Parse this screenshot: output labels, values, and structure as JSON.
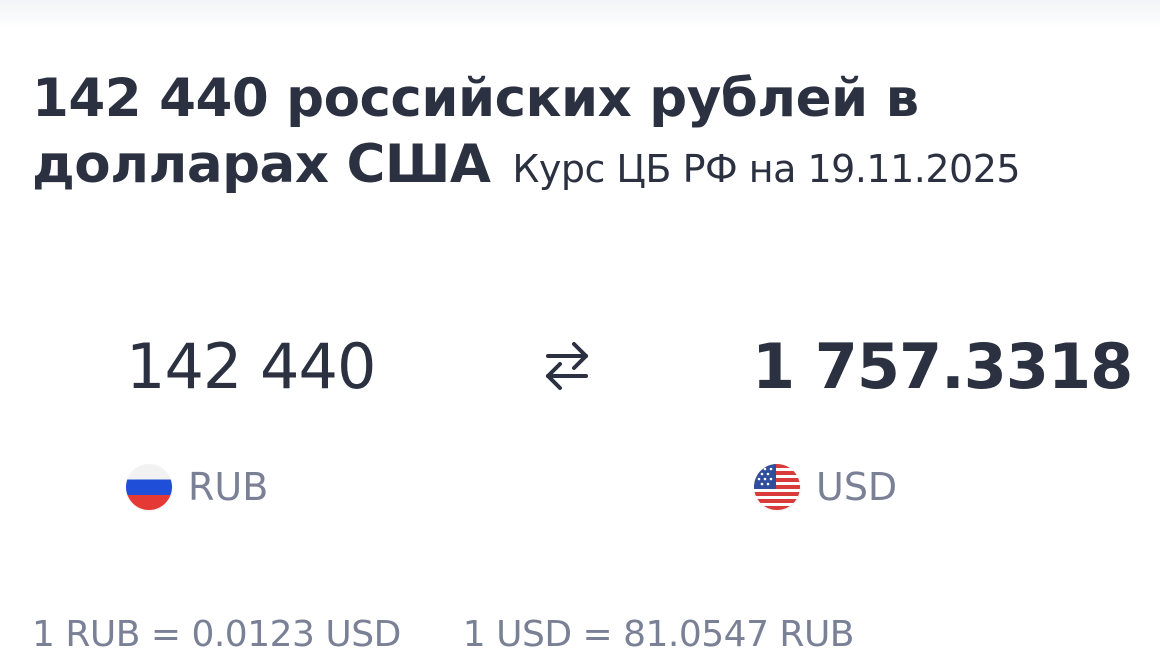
{
  "header": {
    "title": "142 440 российских рублей в долларах США",
    "subtitle": "Курс ЦБ РФ на 19.11.2025"
  },
  "converter": {
    "from": {
      "amount": "142 440",
      "code": "RUB",
      "flag_icon": "russia-flag-icon"
    },
    "to": {
      "amount": "1 757.3318",
      "code": "USD",
      "flag_icon": "usa-flag-icon"
    },
    "swap_icon": "swap-arrows-icon"
  },
  "rates": {
    "forward": "1 RUB = 0.0123 USD",
    "reverse": "1 USD = 81.0547 RUB"
  },
  "colors": {
    "text_dark": "#2b3141",
    "text_muted": "#7a8196",
    "russia_white": "#f2f2f2",
    "russia_blue": "#1f4fd8",
    "russia_red": "#e53935",
    "usa_red": "#d93a3a",
    "usa_blue": "#2f4f9c"
  }
}
